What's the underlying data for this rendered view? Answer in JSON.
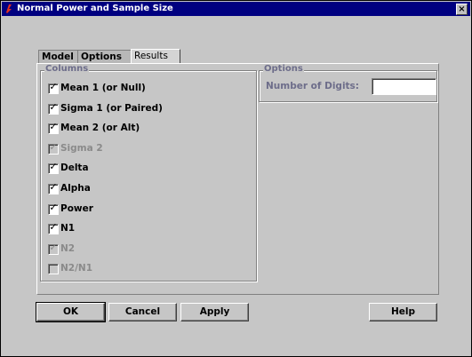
{
  "window": {
    "title": "Normal Power and Sample Size",
    "close_label": "×"
  },
  "tabs": [
    {
      "label": "Model",
      "active": false
    },
    {
      "label": "Options",
      "active": false
    },
    {
      "label": "Results",
      "active": true
    }
  ],
  "columns": {
    "legend": "Columns",
    "items": [
      {
        "label": "Mean 1 (or Null)",
        "checked": true,
        "enabled": true
      },
      {
        "label": "Sigma 1 (or Paired)",
        "checked": true,
        "enabled": true
      },
      {
        "label": "Mean 2 (or Alt)",
        "checked": true,
        "enabled": true
      },
      {
        "label": "Sigma 2",
        "checked": true,
        "enabled": false
      },
      {
        "label": "Delta",
        "checked": true,
        "enabled": true
      },
      {
        "label": "Alpha",
        "checked": true,
        "enabled": true
      },
      {
        "label": "Power",
        "checked": true,
        "enabled": true
      },
      {
        "label": "N1",
        "checked": true,
        "enabled": true
      },
      {
        "label": "N2",
        "checked": true,
        "enabled": false
      },
      {
        "label": "N2/N1",
        "checked": false,
        "enabled": false
      }
    ]
  },
  "options": {
    "legend": "Options",
    "digits_label": "Number of Digits:",
    "digits_value": ""
  },
  "buttons": {
    "ok": "OK",
    "cancel": "Cancel",
    "apply": "Apply",
    "help": "Help"
  }
}
